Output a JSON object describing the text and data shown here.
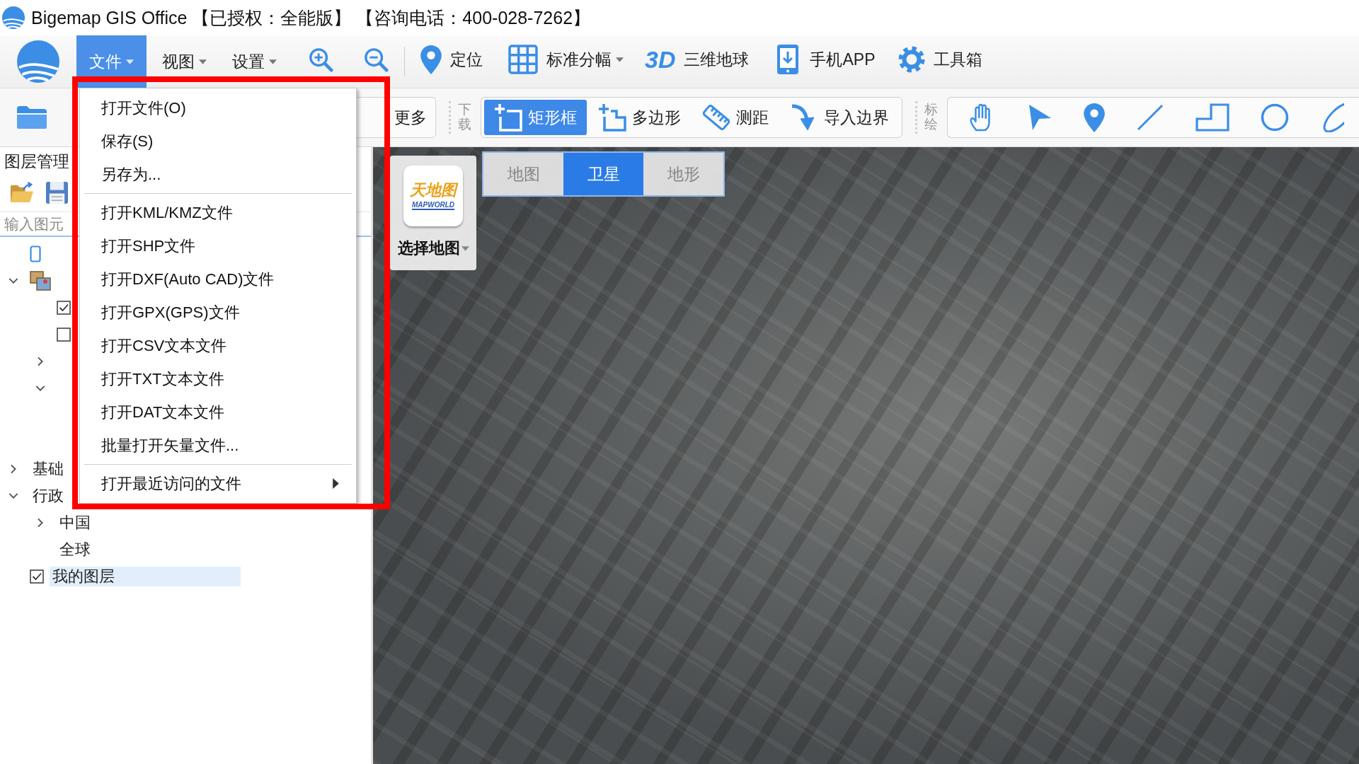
{
  "window": {
    "title": "Bigemap GIS Office 【已授权：全能版】 【咨询电话：400-028-7262】"
  },
  "menu_bar": {
    "menus": [
      {
        "label": "文件",
        "selected": true
      },
      {
        "label": "视图",
        "selected": false
      },
      {
        "label": "设置",
        "selected": false
      }
    ],
    "tools": [
      {
        "kind": "zoom-in",
        "dropdown": false
      },
      {
        "kind": "zoom-out",
        "dropdown": false
      },
      {
        "kind": "locate",
        "label": "定位",
        "dropdown": false
      },
      {
        "kind": "grid",
        "label": "标准分幅",
        "dropdown": true
      },
      {
        "kind": "globe",
        "badge": "3D",
        "label": "三维地球",
        "dropdown": false
      },
      {
        "kind": "phone",
        "label": "手机APP",
        "dropdown": false
      },
      {
        "kind": "gear",
        "label": "工具箱",
        "dropdown": false
      }
    ]
  },
  "toolbar": {
    "more_button": "更多",
    "groups": [
      {
        "title": "下载",
        "tools": [
          {
            "kind": "rectangle",
            "label": "矩形框",
            "selected": true
          },
          {
            "kind": "polygon",
            "label": "多边形",
            "selected": false
          },
          {
            "kind": "ruler",
            "label": "测距",
            "selected": false
          },
          {
            "kind": "import",
            "label": "导入边界",
            "selected": false
          }
        ]
      },
      {
        "title": "标绘",
        "tools": [
          {
            "kind": "hand",
            "selected": false
          },
          {
            "kind": "pointer",
            "selected": false
          },
          {
            "kind": "pin",
            "selected": false
          },
          {
            "kind": "line",
            "selected": false
          },
          {
            "kind": "step",
            "selected": false
          },
          {
            "kind": "circle",
            "selected": false
          },
          {
            "kind": "ellipse",
            "selected": false
          }
        ]
      }
    ]
  },
  "sidebar": {
    "title": "图层管理",
    "search": {
      "placeholder": "输入图元"
    },
    "tree": [
      {
        "kind": "device",
        "selected": false
      },
      {
        "kind": "group",
        "expanded": true,
        "selected": false,
        "children": [
          {
            "kind": "check",
            "checked": true,
            "selected": false
          },
          {
            "kind": "check",
            "checked": false,
            "selected": false
          },
          {
            "kind": "folder",
            "expanded": false,
            "selected": false
          },
          {
            "kind": "folder",
            "expanded": true,
            "selected": false
          }
        ]
      },
      {
        "kind": "folder",
        "label": "基础",
        "expanded": false,
        "selected": false
      },
      {
        "kind": "folder",
        "label": "行政",
        "expanded": true,
        "selected": false,
        "children": [
          {
            "kind": "folder",
            "label": "中国",
            "expanded": false,
            "selected": false
          },
          {
            "kind": "item",
            "label": "全球",
            "selected": false
          }
        ]
      },
      {
        "kind": "check",
        "label": "我的图层",
        "checked": true,
        "selected": true
      }
    ]
  },
  "map": {
    "provider_logo": {
      "name": "天地图",
      "subtitle": "MAPWORLD"
    },
    "select_label": "选择地图",
    "types": [
      {
        "label": "地图",
        "selected": false
      },
      {
        "label": "卫星",
        "selected": true
      },
      {
        "label": "地形",
        "selected": false
      }
    ]
  },
  "file_menu": {
    "items": [
      {
        "kind": "item",
        "label": "打开文件(O)"
      },
      {
        "kind": "item",
        "label": "保存(S)"
      },
      {
        "kind": "item",
        "label": "另存为..."
      },
      {
        "kind": "separator"
      },
      {
        "kind": "item",
        "label": "打开KML/KMZ文件"
      },
      {
        "kind": "item",
        "label": "打开SHP文件"
      },
      {
        "kind": "item",
        "label": "打开DXF(Auto CAD)文件"
      },
      {
        "kind": "item",
        "label": "打开GPX(GPS)文件"
      },
      {
        "kind": "item",
        "label": "打开CSV文本文件"
      },
      {
        "kind": "item",
        "label": "打开TXT文本文件"
      },
      {
        "kind": "item",
        "label": "打开DAT文本文件"
      },
      {
        "kind": "item",
        "label": "批量打开矢量文件..."
      },
      {
        "kind": "separator"
      },
      {
        "kind": "submenu",
        "label": "打开最近访问的文件"
      }
    ]
  },
  "highlight_frame": true
}
